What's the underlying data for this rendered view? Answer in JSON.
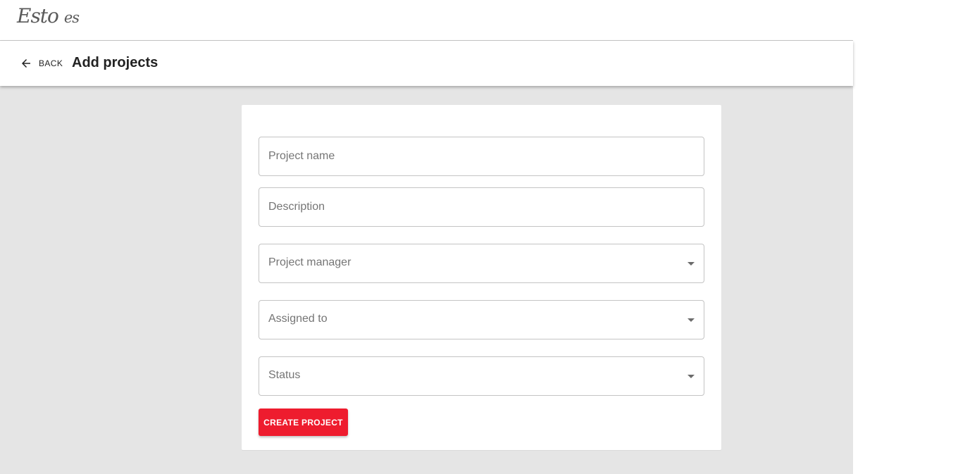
{
  "brand": {
    "logo_main": "Esto",
    "logo_small": "es"
  },
  "header": {
    "back_label": "BACK",
    "title": "Add projects"
  },
  "form": {
    "project_name_placeholder": "Project name",
    "description_placeholder": "Description",
    "project_manager_label": "Project manager",
    "assigned_to_label": "Assigned to",
    "status_label": "Status",
    "submit_label": "CREATE PROJECT"
  },
  "colors": {
    "accent": "#ee1c2e",
    "background": "#e5e5e5"
  }
}
